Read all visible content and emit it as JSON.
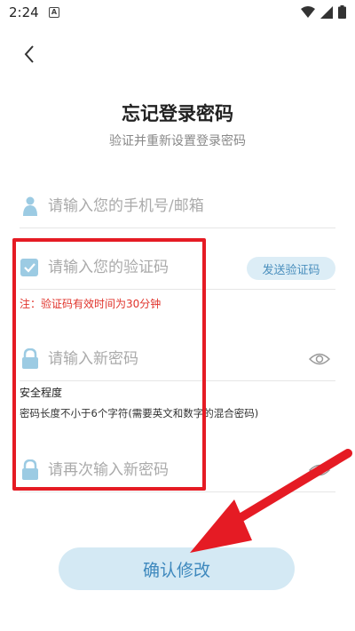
{
  "status": {
    "time": "2:24",
    "notification_letter": "A"
  },
  "header": {
    "title": "忘记登录密码",
    "subtitle": "验证并重新设置登录密码"
  },
  "form": {
    "account_placeholder": "请输入您的手机号/邮箱",
    "code_placeholder": "请输入您的验证码",
    "send_code_label": "发送验证码",
    "code_note": "注：验证码有效时间为30分钟",
    "new_password_placeholder": "请输入新密码",
    "strength_title": "安全程度",
    "strength_desc": "密码长度不小于6个字符(需要英文和数字的混合密码)",
    "confirm_password_placeholder": "请再次输入新密码"
  },
  "actions": {
    "confirm_label": "确认修改"
  },
  "colors": {
    "accent": "#4a8fbd",
    "icon": "#9ccbe3",
    "highlight": "#e51b24"
  }
}
